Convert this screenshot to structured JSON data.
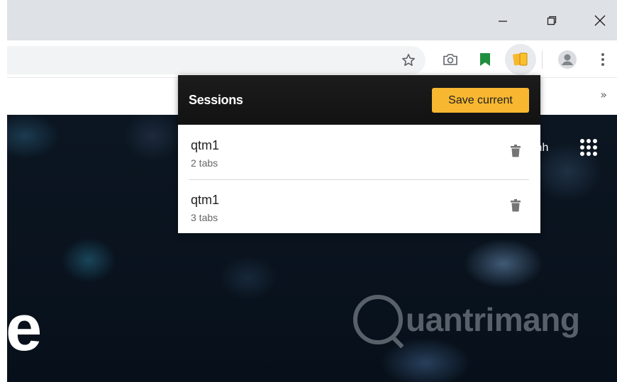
{
  "window": {
    "minimize_icon": "minimize-icon",
    "restore_icon": "restore-icon",
    "close_icon": "close-icon"
  },
  "toolbar": {
    "icons": [
      "star-icon",
      "camera-icon",
      "bookmark-icon",
      "sessions-extension-icon",
      "profile-icon",
      "menu-icon"
    ],
    "accent_green": "#1e8e3e",
    "accent_yellow": "#f7b731"
  },
  "bookmarks": {
    "overflow": "»"
  },
  "page": {
    "user_text": "inh",
    "hero_letter": "e",
    "watermark": "uantrimang"
  },
  "popup": {
    "title": "Sessions",
    "save_button": "Save current",
    "sessions": [
      {
        "name": "qtm1",
        "count": "2 tabs"
      },
      {
        "name": "qtm1",
        "count": "3 tabs"
      }
    ]
  }
}
